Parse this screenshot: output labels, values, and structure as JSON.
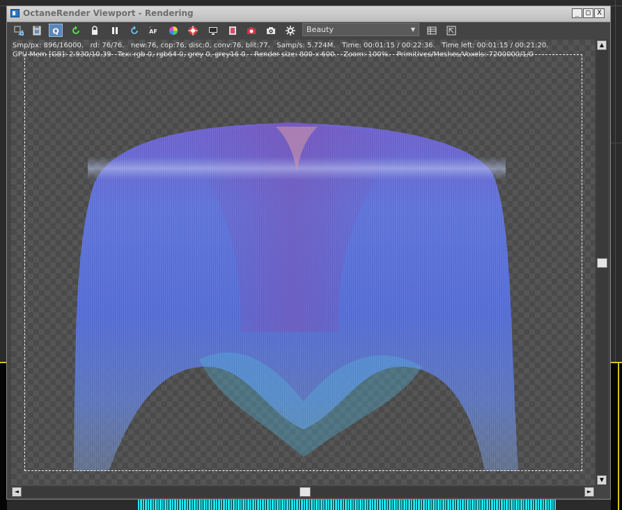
{
  "window": {
    "title": "OctaneRender Viewport - Rendering",
    "controls": {
      "minimize": "_",
      "maximize": "□",
      "close": "X"
    }
  },
  "toolbar": {
    "buttons": [
      {
        "name": "send-scene-icon",
        "active": false
      },
      {
        "name": "clipboard-icon",
        "active": false
      },
      {
        "name": "q-icon",
        "label": "Q",
        "active": true
      },
      {
        "name": "restart-icon",
        "active": false
      },
      {
        "name": "lock-icon",
        "active": false
      },
      {
        "name": "pause-icon",
        "active": false
      },
      {
        "name": "refresh-icon",
        "active": false
      },
      {
        "name": "af-icon",
        "label": "AF",
        "active": false
      },
      {
        "name": "color-wheel-icon",
        "active": false
      },
      {
        "name": "target-icon",
        "active": false
      },
      {
        "name": "monitor-icon",
        "active": false
      },
      {
        "name": "film-icon",
        "active": false
      },
      {
        "name": "camera-red-icon",
        "active": false
      },
      {
        "name": "camera-icon",
        "active": false
      },
      {
        "name": "settings-icon",
        "active": false
      }
    ],
    "render_pass": "Beauty",
    "right_icons": [
      "list-icon",
      "region-icon"
    ]
  },
  "stats": {
    "line1": "Smp/px: 896/16000.   rd: 76/76.   new:76, cop:76, disc:0, conv:76, blit:77.   Samp/s: 5.724M.   Time: 00:01:15 / 00:22:36.   Time left: 00:01:15 / 00:21:20.",
    "line2": "GPU Mem [GB]: 2.930/10.39   Tex: rgb 0, rgb64 0, grey 0, grey16 0.   Render size: 800 x 600.   Zoom: 100%.   Primitives/Meshes/Voxels: 7200000/1/0"
  },
  "scroll": {
    "vertical_position": 0.5,
    "horizontal_position": 0.5
  },
  "colors": {
    "hair_blue": "#5a6fd6",
    "hair_violet": "#7a55b8",
    "hair_cyan": "#54b6e0",
    "active_button": "#5b86b8"
  }
}
